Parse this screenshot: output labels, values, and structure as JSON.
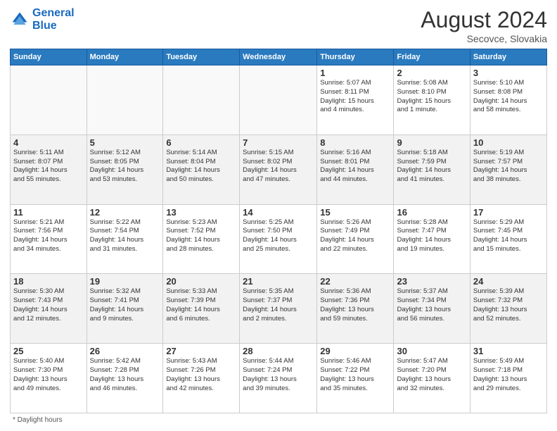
{
  "header": {
    "logo_line1": "General",
    "logo_line2": "Blue",
    "month_year": "August 2024",
    "location": "Secovce, Slovakia"
  },
  "footer": {
    "note": "* Daylight hours"
  },
  "days_of_week": [
    "Sunday",
    "Monday",
    "Tuesday",
    "Wednesday",
    "Thursday",
    "Friday",
    "Saturday"
  ],
  "weeks": [
    [
      {
        "day": "",
        "info": ""
      },
      {
        "day": "",
        "info": ""
      },
      {
        "day": "",
        "info": ""
      },
      {
        "day": "",
        "info": ""
      },
      {
        "day": "1",
        "info": "Sunrise: 5:07 AM\nSunset: 8:11 PM\nDaylight: 15 hours\nand 4 minutes."
      },
      {
        "day": "2",
        "info": "Sunrise: 5:08 AM\nSunset: 8:10 PM\nDaylight: 15 hours\nand 1 minute."
      },
      {
        "day": "3",
        "info": "Sunrise: 5:10 AM\nSunset: 8:08 PM\nDaylight: 14 hours\nand 58 minutes."
      }
    ],
    [
      {
        "day": "4",
        "info": "Sunrise: 5:11 AM\nSunset: 8:07 PM\nDaylight: 14 hours\nand 55 minutes."
      },
      {
        "day": "5",
        "info": "Sunrise: 5:12 AM\nSunset: 8:05 PM\nDaylight: 14 hours\nand 53 minutes."
      },
      {
        "day": "6",
        "info": "Sunrise: 5:14 AM\nSunset: 8:04 PM\nDaylight: 14 hours\nand 50 minutes."
      },
      {
        "day": "7",
        "info": "Sunrise: 5:15 AM\nSunset: 8:02 PM\nDaylight: 14 hours\nand 47 minutes."
      },
      {
        "day": "8",
        "info": "Sunrise: 5:16 AM\nSunset: 8:01 PM\nDaylight: 14 hours\nand 44 minutes."
      },
      {
        "day": "9",
        "info": "Sunrise: 5:18 AM\nSunset: 7:59 PM\nDaylight: 14 hours\nand 41 minutes."
      },
      {
        "day": "10",
        "info": "Sunrise: 5:19 AM\nSunset: 7:57 PM\nDaylight: 14 hours\nand 38 minutes."
      }
    ],
    [
      {
        "day": "11",
        "info": "Sunrise: 5:21 AM\nSunset: 7:56 PM\nDaylight: 14 hours\nand 34 minutes."
      },
      {
        "day": "12",
        "info": "Sunrise: 5:22 AM\nSunset: 7:54 PM\nDaylight: 14 hours\nand 31 minutes."
      },
      {
        "day": "13",
        "info": "Sunrise: 5:23 AM\nSunset: 7:52 PM\nDaylight: 14 hours\nand 28 minutes."
      },
      {
        "day": "14",
        "info": "Sunrise: 5:25 AM\nSunset: 7:50 PM\nDaylight: 14 hours\nand 25 minutes."
      },
      {
        "day": "15",
        "info": "Sunrise: 5:26 AM\nSunset: 7:49 PM\nDaylight: 14 hours\nand 22 minutes."
      },
      {
        "day": "16",
        "info": "Sunrise: 5:28 AM\nSunset: 7:47 PM\nDaylight: 14 hours\nand 19 minutes."
      },
      {
        "day": "17",
        "info": "Sunrise: 5:29 AM\nSunset: 7:45 PM\nDaylight: 14 hours\nand 15 minutes."
      }
    ],
    [
      {
        "day": "18",
        "info": "Sunrise: 5:30 AM\nSunset: 7:43 PM\nDaylight: 14 hours\nand 12 minutes."
      },
      {
        "day": "19",
        "info": "Sunrise: 5:32 AM\nSunset: 7:41 PM\nDaylight: 14 hours\nand 9 minutes."
      },
      {
        "day": "20",
        "info": "Sunrise: 5:33 AM\nSunset: 7:39 PM\nDaylight: 14 hours\nand 6 minutes."
      },
      {
        "day": "21",
        "info": "Sunrise: 5:35 AM\nSunset: 7:37 PM\nDaylight: 14 hours\nand 2 minutes."
      },
      {
        "day": "22",
        "info": "Sunrise: 5:36 AM\nSunset: 7:36 PM\nDaylight: 13 hours\nand 59 minutes."
      },
      {
        "day": "23",
        "info": "Sunrise: 5:37 AM\nSunset: 7:34 PM\nDaylight: 13 hours\nand 56 minutes."
      },
      {
        "day": "24",
        "info": "Sunrise: 5:39 AM\nSunset: 7:32 PM\nDaylight: 13 hours\nand 52 minutes."
      }
    ],
    [
      {
        "day": "25",
        "info": "Sunrise: 5:40 AM\nSunset: 7:30 PM\nDaylight: 13 hours\nand 49 minutes."
      },
      {
        "day": "26",
        "info": "Sunrise: 5:42 AM\nSunset: 7:28 PM\nDaylight: 13 hours\nand 46 minutes."
      },
      {
        "day": "27",
        "info": "Sunrise: 5:43 AM\nSunset: 7:26 PM\nDaylight: 13 hours\nand 42 minutes."
      },
      {
        "day": "28",
        "info": "Sunrise: 5:44 AM\nSunset: 7:24 PM\nDaylight: 13 hours\nand 39 minutes."
      },
      {
        "day": "29",
        "info": "Sunrise: 5:46 AM\nSunset: 7:22 PM\nDaylight: 13 hours\nand 35 minutes."
      },
      {
        "day": "30",
        "info": "Sunrise: 5:47 AM\nSunset: 7:20 PM\nDaylight: 13 hours\nand 32 minutes."
      },
      {
        "day": "31",
        "info": "Sunrise: 5:49 AM\nSunset: 7:18 PM\nDaylight: 13 hours\nand 29 minutes."
      }
    ]
  ]
}
